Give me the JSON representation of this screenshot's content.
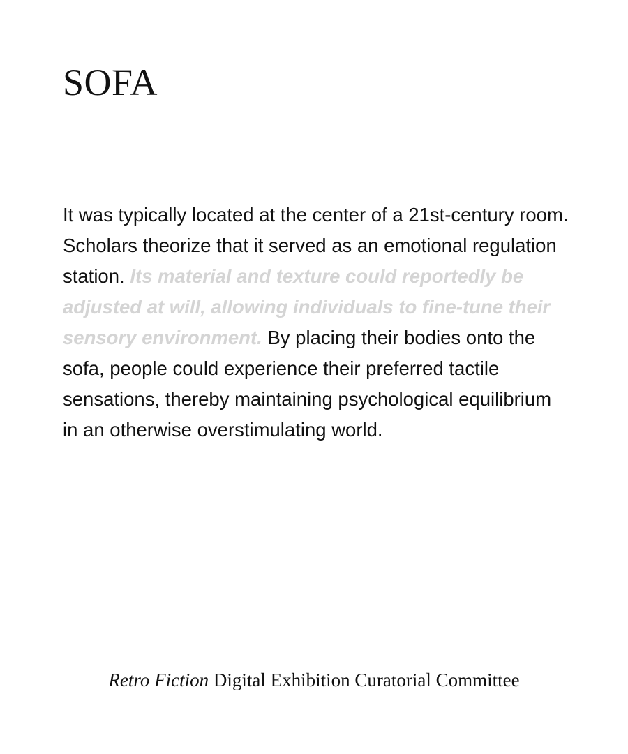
{
  "title": "SOFA",
  "paragraph": {
    "intro": "It was typically located at the center of a 21st-century room. Scholars theorize that it served as an emotional regulation station.",
    "faded": "Its material and texture could reportedly be adjusted at will, allowing individuals to fine-tune their sensory environment.",
    "outro": "By placing their bodies onto the sofa, people could experience their preferred tactile sensations, thereby maintaining psychological equilibrium in an otherwise overstimulating world."
  },
  "credit": {
    "italic": "Retro Fiction",
    "rest": "Digital Exhibition Curatorial Committee"
  },
  "colors": {
    "text": "#111111",
    "faded_text": "#d4d4d4",
    "background": "#ffffff"
  }
}
